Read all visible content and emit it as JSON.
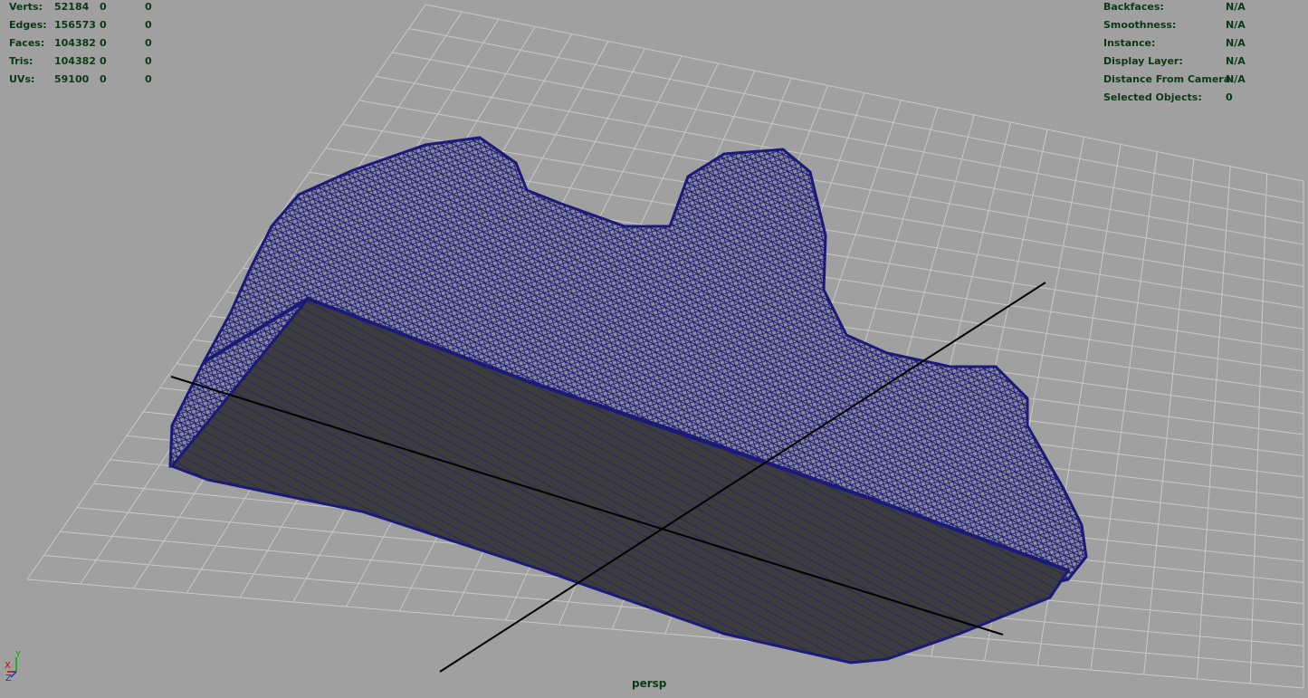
{
  "app": "Maya viewport",
  "stats_left": [
    {
      "label": "Verts:",
      "values": [
        "52184",
        "0",
        "0"
      ]
    },
    {
      "label": "Edges:",
      "values": [
        "156573",
        "0",
        "0"
      ]
    },
    {
      "label": "Faces:",
      "values": [
        "104382",
        "0",
        "0"
      ]
    },
    {
      "label": "Tris:",
      "values": [
        "104382",
        "0",
        "0"
      ]
    },
    {
      "label": "UVs:",
      "values": [
        "59100",
        "0",
        "0"
      ]
    }
  ],
  "stats_right": [
    {
      "label": "Backfaces:",
      "value": "N/A"
    },
    {
      "label": "Smoothness:",
      "value": "N/A"
    },
    {
      "label": "Instance:",
      "value": "N/A"
    },
    {
      "label": "Display Layer:",
      "value": "N/A"
    },
    {
      "label": "Distance From Camera:",
      "value": "N/A"
    },
    {
      "label": "Selected Objects:",
      "value": "0"
    }
  ],
  "camera_name": "persp",
  "axis_labels": {
    "x": "X",
    "y": "Y",
    "z": "Z"
  },
  "colors": {
    "background": "#a0a0a0",
    "grid": "#8a8a8a",
    "grid_light": "#c8c8c8",
    "wire": "#1a1a7a",
    "face_dark": "#3c3c3c",
    "hud_text": "#0a3a14",
    "axis_x": "#d00000",
    "axis_y": "#00b000",
    "axis_z": "#0040d0"
  },
  "icons": {
    "axis_gizmo": "xyz-axis-icon"
  }
}
